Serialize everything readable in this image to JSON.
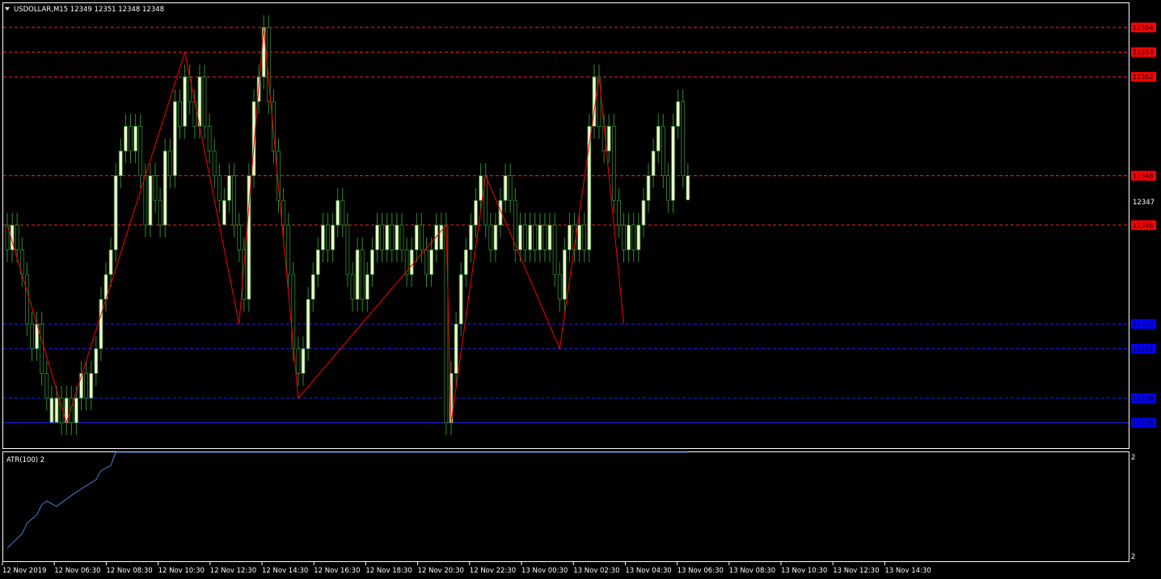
{
  "header": {
    "symbol_text": "USDOLLAR,M15  12349 12351 12348 12348"
  },
  "indicator": {
    "label": "ATR(100) 2",
    "scale_top": "2",
    "scale_bottom": "2",
    "color": "#4a7fd6"
  },
  "colors": {
    "background": "#000000",
    "frame": "#ffffff",
    "bull_candle_fill": "#f5f5d0",
    "candle_outline": "#2e8b2e",
    "zigzag": "#ff0000",
    "resistance_line": "#ff2020",
    "support_line": "#2020ff",
    "resistance_label_bg": "#ff0000",
    "support_label_bg": "#0000ff"
  },
  "price_axis": {
    "current_label": "12347",
    "resistance_levels": [
      {
        "price": 12354,
        "label": "12354"
      },
      {
        "price": 12353,
        "label": "12353"
      },
      {
        "price": 12352,
        "label": "12352"
      },
      {
        "price": 12348,
        "label": "12348"
      },
      {
        "price": 12346,
        "label": "12346"
      }
    ],
    "support_levels": [
      {
        "price": 12342,
        "label": "12342"
      },
      {
        "price": 12341,
        "label": "12341"
      },
      {
        "price": 12339,
        "label": "12339"
      },
      {
        "price": 12338,
        "label": "12338",
        "solid": true
      }
    ]
  },
  "time_axis": {
    "labels": [
      "12 Nov 2019",
      "12 Nov 06:30",
      "12 Nov 08:30",
      "12 Nov 10:30",
      "12 Nov 12:30",
      "12 Nov 14:30",
      "12 Nov 16:30",
      "12 Nov 18:30",
      "12 Nov 20:30",
      "12 Nov 22:30",
      "13 Nov 00:30",
      "13 Nov 02:30",
      "13 Nov 04:30",
      "13 Nov 06:30",
      "13 Nov 08:30",
      "13 Nov 10:30",
      "13 Nov 12:30",
      "13 Nov 14:30"
    ]
  },
  "chart_data": {
    "type": "candlestick",
    "ylim": [
      12337.5,
      12355
    ],
    "zigzag_points": [
      {
        "bar": 0,
        "price": 12346
      },
      {
        "bar": 12,
        "price": 12338
      },
      {
        "bar": 36,
        "price": 12353
      },
      {
        "bar": 47,
        "price": 12342
      },
      {
        "bar": 52,
        "price": 12354
      },
      {
        "bar": 59,
        "price": 12339
      },
      {
        "bar": 89,
        "price": 12346
      },
      {
        "bar": 90,
        "price": 12338
      },
      {
        "bar": 97,
        "price": 12348
      },
      {
        "bar": 112,
        "price": 12341
      },
      {
        "bar": 120,
        "price": 12352
      },
      {
        "bar": 125,
        "price": 12342
      }
    ],
    "closes": [
      12345,
      12346,
      12345,
      12344,
      12342,
      12341,
      12342,
      12340,
      12339,
      12339,
      12339,
      12338,
      12339,
      12338,
      12339,
      12340,
      12339,
      12340,
      12341,
      12343,
      12344,
      12345,
      12348,
      12349,
      12350,
      12349,
      12350,
      12348,
      12346,
      12348,
      12347,
      12346,
      12349,
      12348,
      12351,
      12350,
      12352,
      12351,
      12350,
      12352,
      12350,
      12349,
      12348,
      12347,
      12347,
      12348,
      12346,
      12345,
      12343,
      12348,
      12351,
      12352,
      12354,
      12351,
      12349,
      12347,
      12346,
      12344,
      12341,
      12340,
      12341,
      12343,
      12344,
      12345,
      12346,
      12345,
      12346,
      12347,
      12346,
      12344,
      12343,
      12345,
      12343,
      12344,
      12345,
      12346,
      12345,
      12346,
      12345,
      12346,
      12345,
      12344,
      12345,
      12346,
      12345,
      12344,
      12345,
      12346,
      12346,
      12338,
      12340,
      12342,
      12344,
      12345,
      12346,
      12347,
      12348,
      12346,
      12345,
      12346,
      12347,
      12348,
      12347,
      12345,
      12346,
      12345,
      12346,
      12345,
      12346,
      12345,
      12346,
      12344,
      12343,
      12345,
      12346,
      12345,
      12346,
      12345,
      12350,
      12352,
      12350,
      12349,
      12350,
      12347,
      12346,
      12345,
      12346,
      12345,
      12346,
      12347,
      12348,
      12349,
      12350,
      12348,
      12347,
      12350,
      12351,
      12348,
      12348
    ]
  }
}
